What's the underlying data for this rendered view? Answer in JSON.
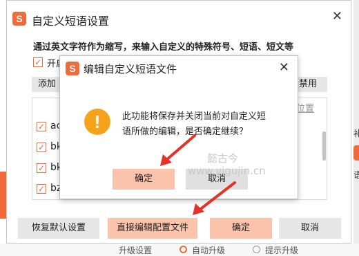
{
  "main_dialog": {
    "logo_glyph": "S",
    "title": "自定义短语设置",
    "close_glyph": "✕",
    "description": "通过英文字符作为缩写，来输入自定义的特殊符号、短语、短文等",
    "enable_label": "开启",
    "add_label": "添加",
    "disable_label": "禁用",
    "list": {
      "position_header": "位置",
      "rows": [
        {
          "text": "ac",
          "checked": true
        },
        {
          "text": "bk",
          "checked": true
        },
        {
          "text": "bk",
          "checked": true
        },
        {
          "text": "bz",
          "checked": true
        }
      ]
    },
    "buttons": {
      "restore": "恢复默认设置",
      "edit_config": "直接编辑配置文件",
      "confirm": "确定",
      "cancel": "取消"
    }
  },
  "modal": {
    "logo_glyph": "S",
    "title": "编辑自定义短语文件",
    "close_glyph": "✕",
    "warning_glyph": "!",
    "message_line1": "此功能将保存并关闭当前对自定义短",
    "message_line2": "语所做的编辑，是否确定继续？",
    "ok_label": "确定",
    "cancel_label": "取消"
  },
  "background": {
    "right_text1": "补",
    "right_text2": "语",
    "upgrade_settings": "升级设置",
    "auto_upgrade": "自动升级",
    "prompt_upgrade": "提示升级"
  },
  "watermark": {
    "line1": "懿古今",
    "line2": "www.yigujin.cn"
  },
  "colors": {
    "accent": "#f06a3a",
    "accent_light_button": "#fbc3ab",
    "warning": "#f7a21b",
    "arrow": "#e8302a"
  }
}
